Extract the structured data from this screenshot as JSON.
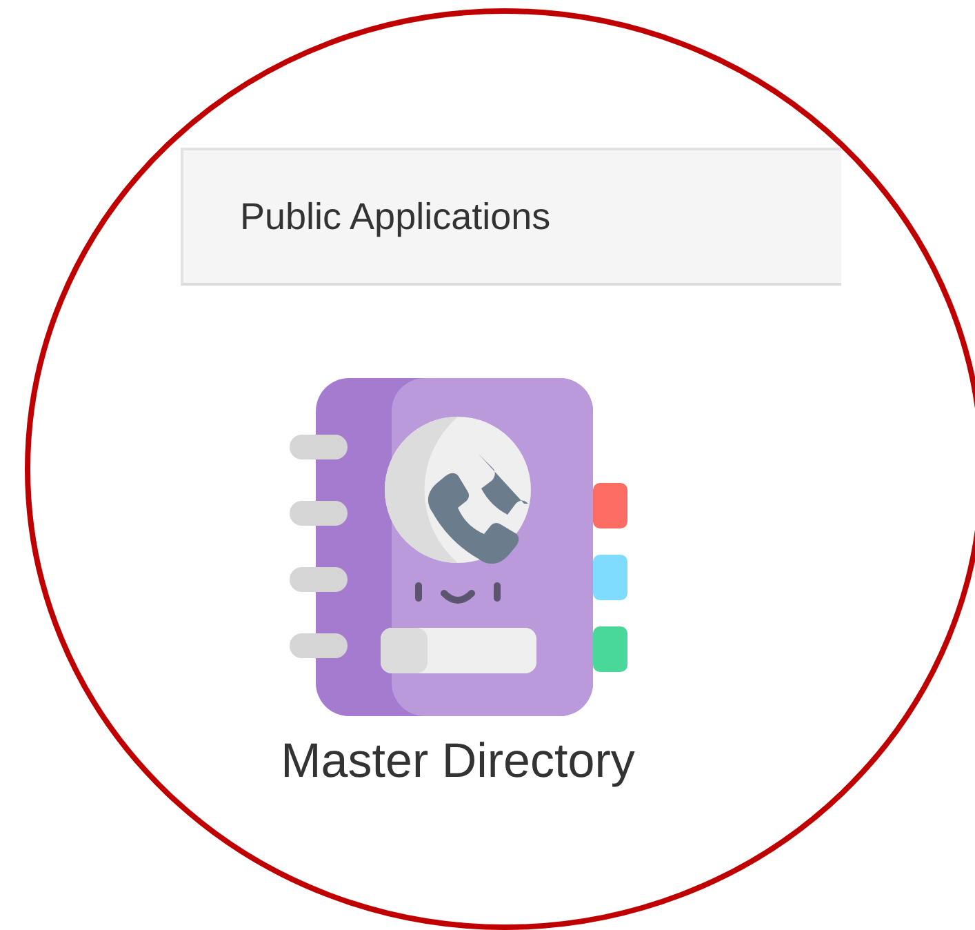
{
  "panel": {
    "title": "Public Applications"
  },
  "apps": [
    {
      "label": "Master Directory",
      "kind": "directory"
    }
  ]
}
